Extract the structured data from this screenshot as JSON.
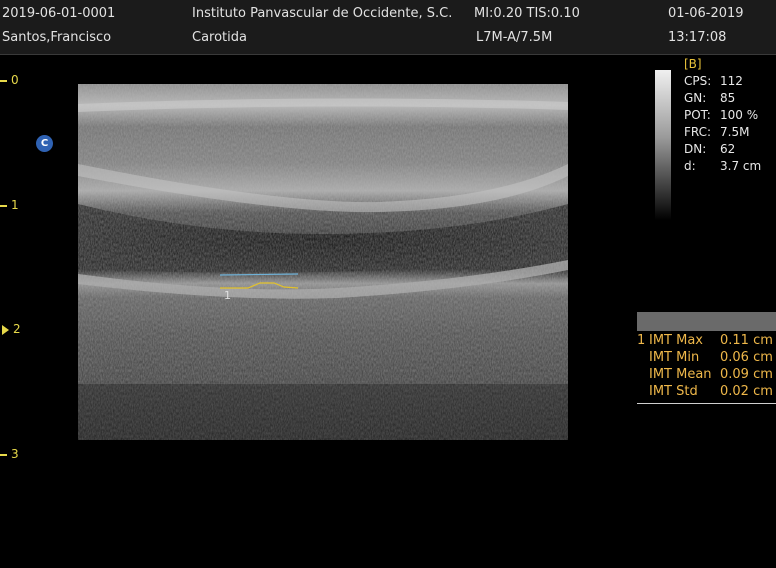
{
  "header": {
    "patient_id": "2019-06-01-0001",
    "patient_name": "Santos,Francisco",
    "institution": "Instituto Panvascular de Occidente, S.C.",
    "mi_tis": "MI:0.20  TIS:0.10",
    "exam": "Carotida",
    "probe": "L7M-A/7.5M",
    "date": "01-06-2019",
    "time": "13:17:08"
  },
  "depth_scale": [
    "0",
    "1",
    "2",
    "3"
  ],
  "focus_marker_at": "2",
  "badge": "C",
  "measurement_label": "1",
  "params": {
    "mode": "[B]",
    "rows": [
      {
        "key": "CPS:",
        "value": "112"
      },
      {
        "key": "GN:",
        "value": "85"
      },
      {
        "key": "POT:",
        "value": "100 %"
      },
      {
        "key": "FRC:",
        "value": "7.5M"
      },
      {
        "key": "DN:",
        "value": "62"
      },
      {
        "key": "d:",
        "value": "3.7 cm"
      }
    ]
  },
  "imt": {
    "rows": [
      {
        "index": "1",
        "label": "IMT Max",
        "value": "0.11 cm"
      },
      {
        "index": "",
        "label": "IMT Min",
        "value": "0.06 cm"
      },
      {
        "index": "",
        "label": "IMT Mean",
        "value": "0.09 cm"
      },
      {
        "index": "",
        "label": "IMT Std",
        "value": "0.02 cm"
      }
    ]
  },
  "colors": {
    "accent_yellow": "#e7d94a",
    "imt_orange": "#efb84a",
    "badge_blue": "#2f62b3",
    "trace_blue": "#6fb2d8"
  }
}
